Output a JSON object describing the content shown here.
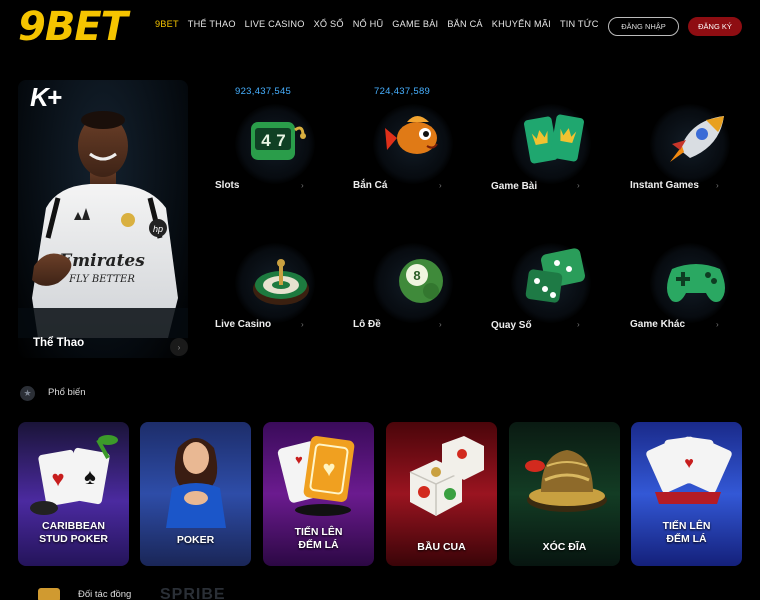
{
  "brand": {
    "logo_text": "9BET"
  },
  "nav": {
    "items": [
      {
        "label": "9BET",
        "active": true
      },
      {
        "label": "THỂ THAO"
      },
      {
        "label": "LIVE CASINO"
      },
      {
        "label": "XỔ SỐ"
      },
      {
        "label": "NỔ HŨ"
      },
      {
        "label": "GAME BÀI"
      },
      {
        "label": "BẮN CÁ"
      },
      {
        "label": "KHUYẾN MÃI"
      },
      {
        "label": "TIN TỨC"
      }
    ],
    "login_label": "ĐĂNG NHẬP",
    "register_label": "ĐĂNG KÝ"
  },
  "sport": {
    "badge": "K+",
    "label": "Thể Thao"
  },
  "games": {
    "row1": [
      {
        "label": "Slots",
        "jackpot": "923,437,545",
        "icon": "slot-machine-icon"
      },
      {
        "label": "Bắn Cá",
        "jackpot": "724,437,589",
        "icon": "fish-icon"
      },
      {
        "label": "Game Bài",
        "icon": "cards-icon"
      },
      {
        "label": "Instant Games",
        "icon": "rocket-icon"
      }
    ],
    "row2": [
      {
        "label": "Live Casino",
        "icon": "roulette-icon"
      },
      {
        "label": "Lô Đề",
        "icon": "lottery-ball-icon"
      },
      {
        "label": "Quay Số",
        "icon": "dice-icon"
      },
      {
        "label": "Game Khác",
        "icon": "gamepad-icon"
      }
    ]
  },
  "popular": {
    "title": "Phổ biến",
    "cards": [
      {
        "label": "CARIBBEAN STUD POKER"
      },
      {
        "label": "POKER"
      },
      {
        "label": "TIẾN LÊN ĐẾM LÁ"
      },
      {
        "label": "BẦU CUA"
      },
      {
        "label": "XÓC ĐĨA"
      },
      {
        "label": "TIẾN LÊN ĐẾM LÁ"
      }
    ]
  },
  "partners": {
    "title": "Đối tác đồng",
    "logos": [
      "SPRIBE"
    ]
  },
  "colors": {
    "accent": "#f5c400",
    "register_bg": "#8e0d12",
    "jackpot": "#47b0ff"
  }
}
